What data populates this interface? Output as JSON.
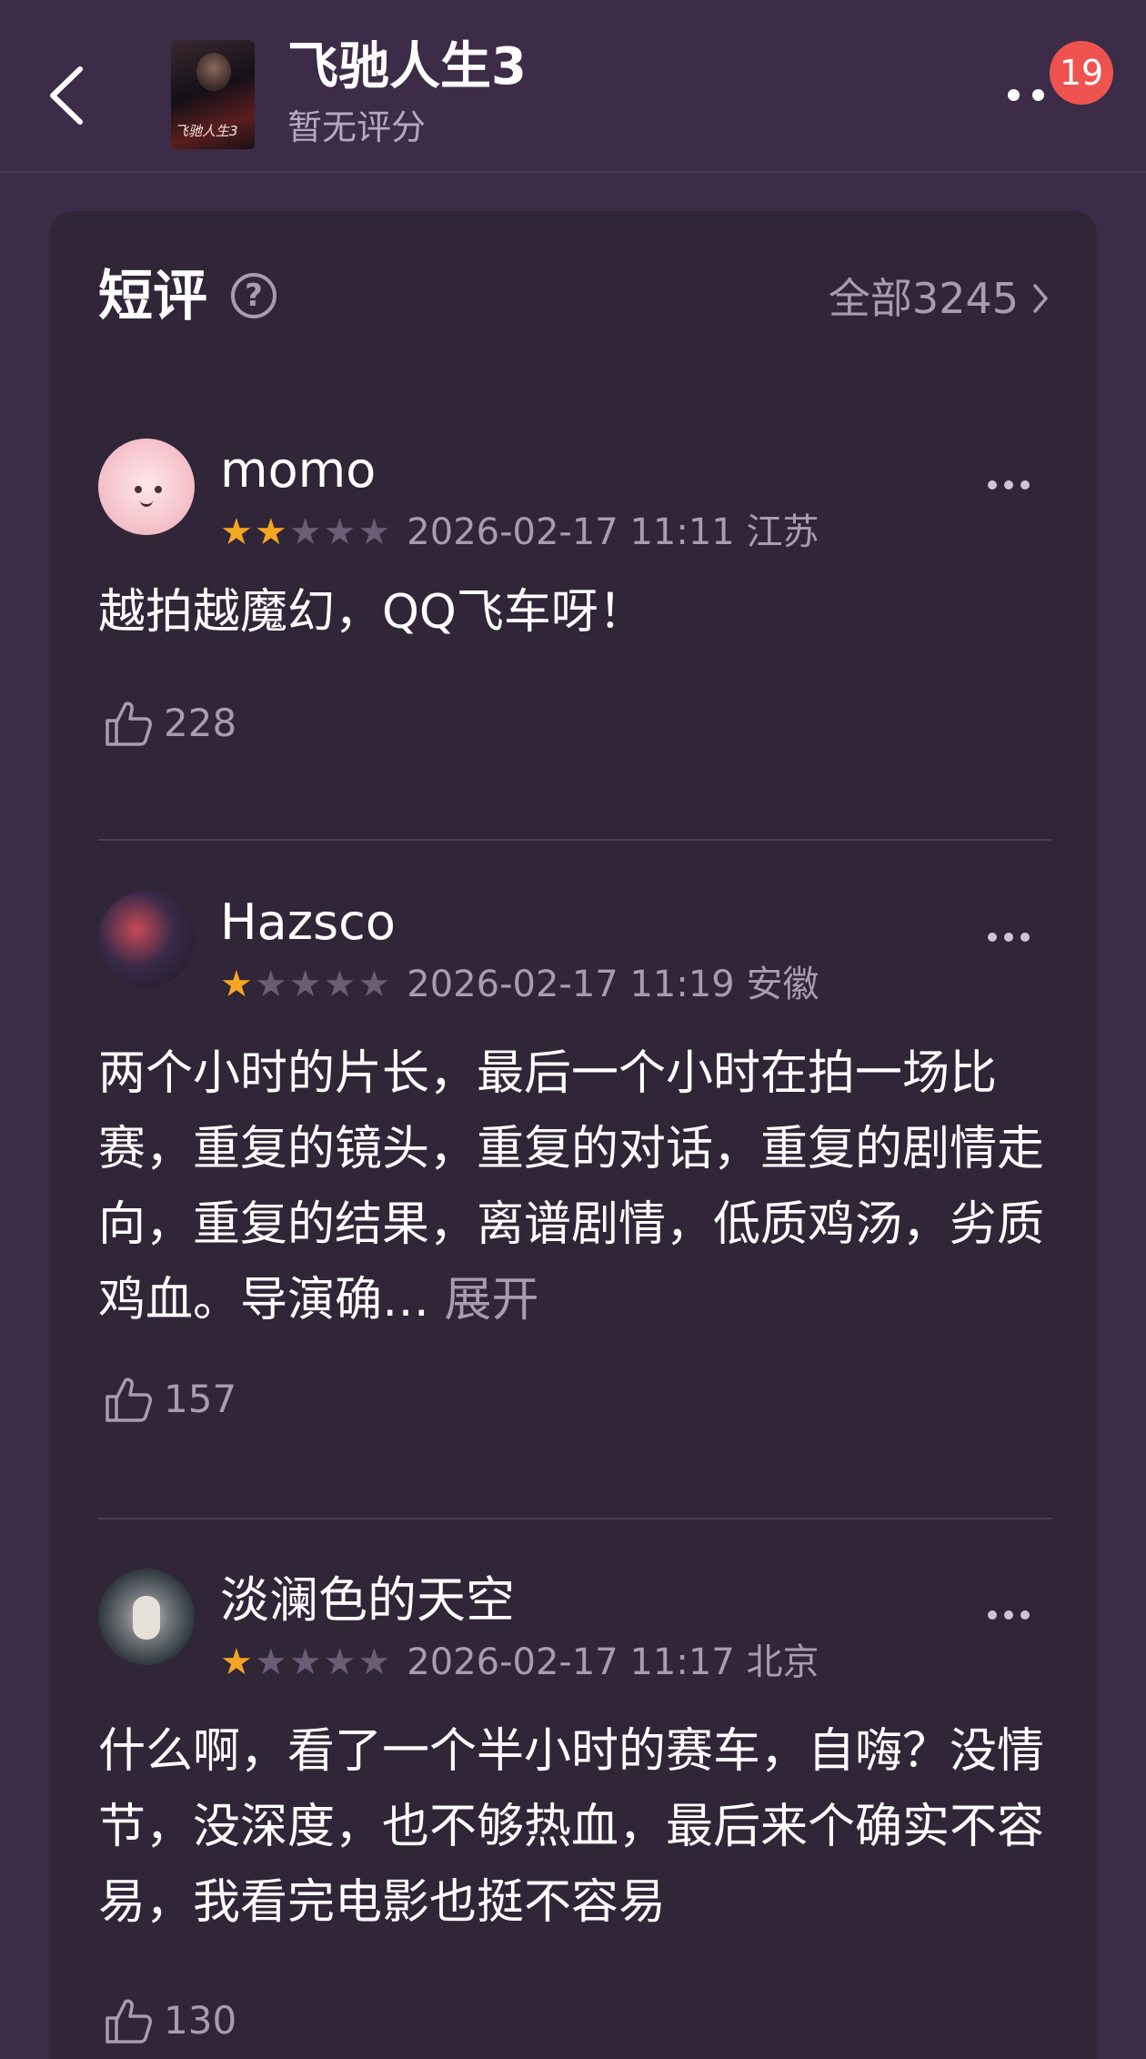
{
  "header": {
    "movie_title": "飞驰人生3",
    "rating_text": "暂无评分",
    "poster_caption": "飞驰人生3",
    "notification_count": "19"
  },
  "section": {
    "title": "短评",
    "help_icon_label": "?",
    "all_label": "全部3245"
  },
  "reviews": [
    {
      "username": "momo",
      "stars": 2,
      "max_stars": 5,
      "timestamp": "2026-02-17 11:11 江苏",
      "text": "越拍越魔幻，QQ飞车呀！",
      "expand_label": "",
      "likes": "228"
    },
    {
      "username": "Hazsco",
      "stars": 1,
      "max_stars": 5,
      "timestamp": "2026-02-17 11:19 安徽",
      "text": "两个小时的片长，最后一个小时在拍一场比赛，重复的镜头，重复的对话，重复的剧情走向，重复的结果，离谱剧情，低质鸡汤，劣质鸡血。导演确… ",
      "expand_label": "展开",
      "likes": "157"
    },
    {
      "username": "淡澜色的天空",
      "stars": 1,
      "max_stars": 5,
      "timestamp": "2026-02-17 11:17 北京",
      "text": "什么啊，看了一个半小时的赛车，自嗨？没情节，没深度，也不够热血，最后来个确实不容易，我看完电影也挺不容易",
      "expand_label": "",
      "likes": "130"
    }
  ],
  "colors": {
    "background": "#3d2c47",
    "card": "#312538",
    "star_active": "#f5a623",
    "badge": "#ee5350",
    "muted_text": "#a99bb2"
  }
}
